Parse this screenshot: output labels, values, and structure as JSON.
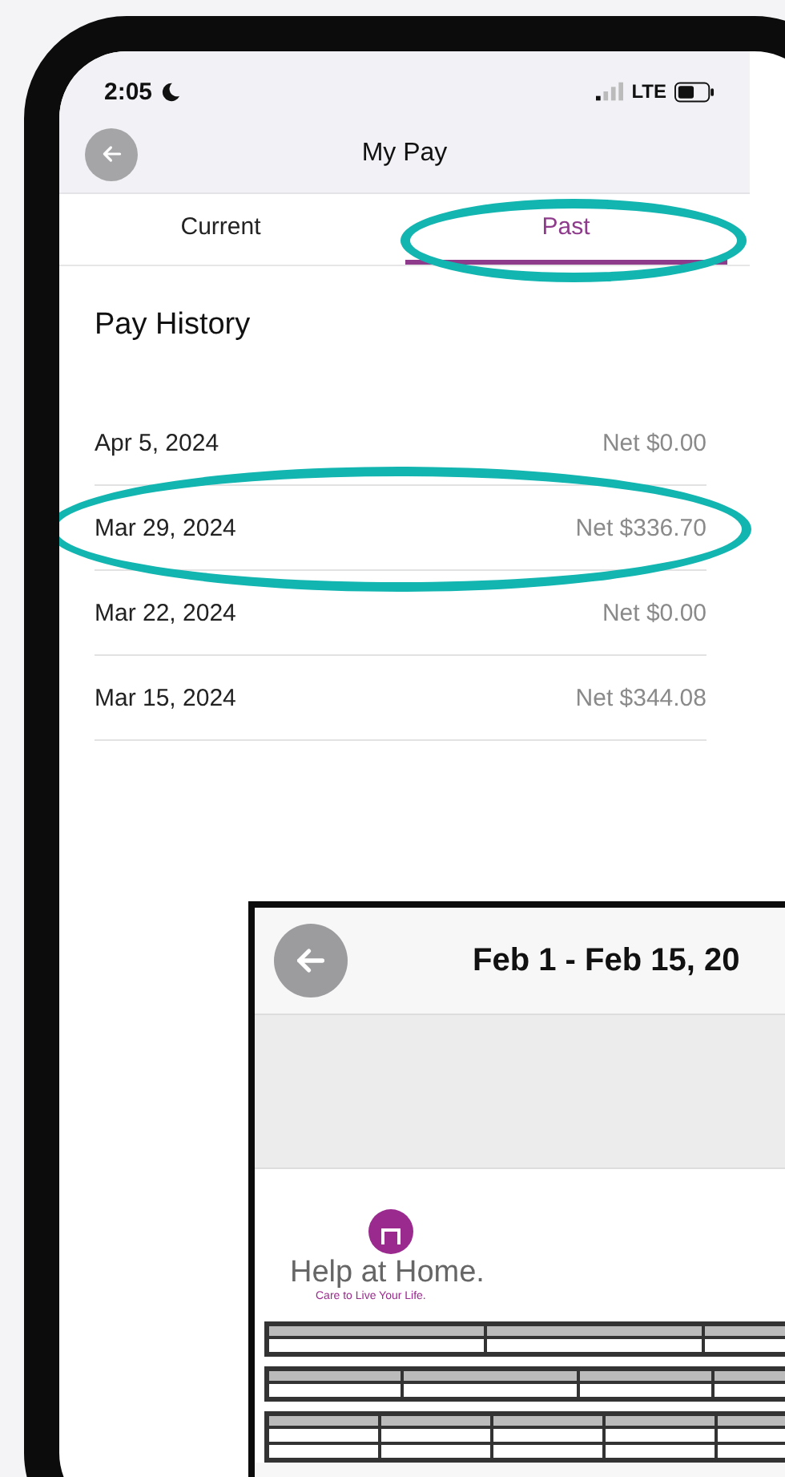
{
  "status_bar": {
    "time": "2:05",
    "network": "LTE"
  },
  "nav": {
    "title": "My Pay"
  },
  "tabs": [
    {
      "label": "Current",
      "selected": false,
      "circled": false
    },
    {
      "label": "Past",
      "selected": true,
      "circled": true
    }
  ],
  "section_title": "Pay History",
  "rows": [
    {
      "date": "Apr 5, 2024",
      "net": "Net $0.00",
      "circled": false
    },
    {
      "date": "Mar 29, 2024",
      "net": "Net $336.70",
      "circled": true
    },
    {
      "date": "Mar 22, 2024",
      "net": "Net $0.00",
      "circled": false
    },
    {
      "date": "Mar 15, 2024",
      "net": "Net $344.08",
      "circled": false
    }
  ],
  "inset": {
    "title": "Feb 1 - Feb 15, 20",
    "logo_name": "Help at Home.",
    "logo_tagline": "Care to Live Your Life."
  }
}
